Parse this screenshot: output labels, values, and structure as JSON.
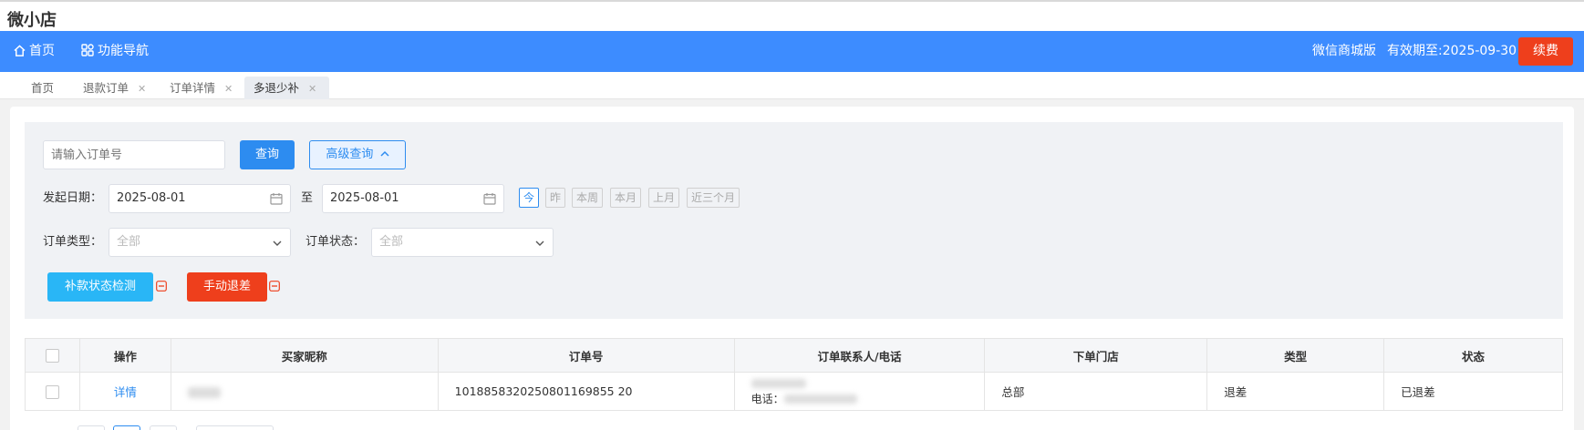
{
  "app": {
    "title": "微小店"
  },
  "topnav": {
    "home_label": "首页",
    "nav_label": "功能导航",
    "edition": "微信商城版",
    "expiry": "有效期至:2025-09-30",
    "renew_label": "续费",
    "colors": {
      "bar": "#3d8cff",
      "renew": "#ee3f1c"
    }
  },
  "tabs": [
    {
      "label": "首页",
      "closable": false,
      "active": false
    },
    {
      "label": "退款订单",
      "closable": true,
      "active": false
    },
    {
      "label": "订单详情",
      "closable": true,
      "active": false
    },
    {
      "label": "多退少补",
      "closable": true,
      "active": true
    }
  ],
  "filter": {
    "order_placeholder": "请输入订单号",
    "query_label": "查询",
    "advanced_label": "高级查询",
    "date_label": "发起日期：",
    "date_from": "2025-08-01",
    "date_sep": "至",
    "date_to": "2025-08-01",
    "quick_ranges": [
      "今",
      "昨",
      "本周",
      "本月",
      "上月",
      "近三个月"
    ],
    "order_type_label": "订单类型：",
    "order_type_value": "全部",
    "order_status_label": "订单状态：",
    "order_status_value": "全部",
    "check_btn": "补款状态检测",
    "manual_btn": "手动退差"
  },
  "table": {
    "headers": [
      "操作",
      "买家昵称",
      "订单号",
      "订单联系人/电话",
      "下单门店",
      "类型",
      "状态"
    ],
    "rows": [
      {
        "action": "详情",
        "order_no": "1018858320250801169855 20",
        "phone_label": "电话：",
        "store": "总部",
        "type": "退差",
        "status": "已退差"
      }
    ]
  }
}
